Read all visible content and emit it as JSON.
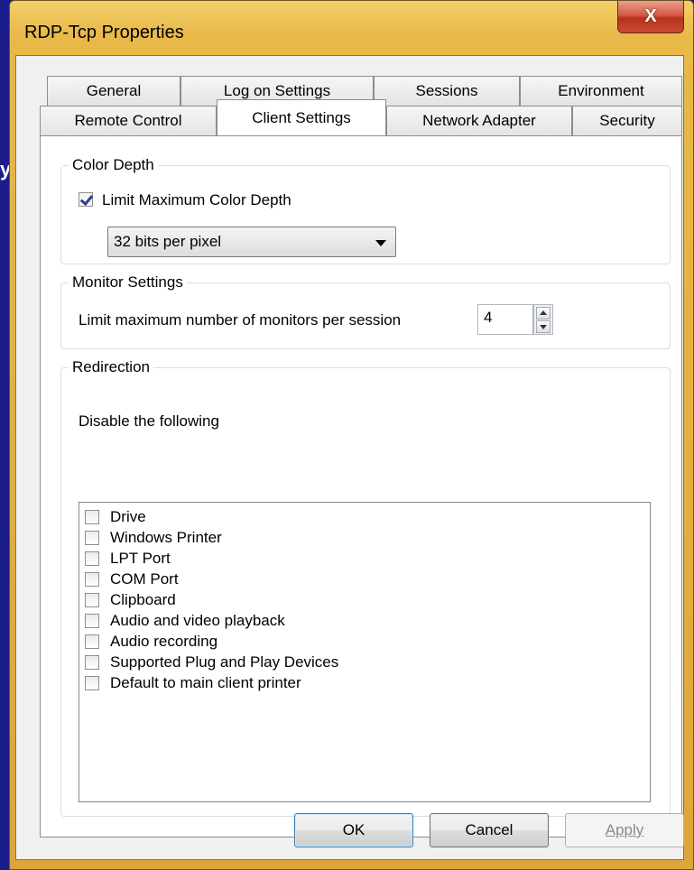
{
  "window": {
    "title": "RDP-Tcp Properties",
    "close_glyph": "X"
  },
  "tabs": {
    "row1": [
      "General",
      "Log on Settings",
      "Sessions",
      "Environment"
    ],
    "row2": [
      "Remote Control",
      "Client Settings",
      "Network Adapter",
      "Security"
    ],
    "active": "Client Settings"
  },
  "color_depth": {
    "legend": "Color Depth",
    "limit_label": "Limit Maximum Color Depth",
    "limit_checked": true,
    "selected_option": "32 bits per pixel"
  },
  "monitor": {
    "legend": "Monitor Settings",
    "label": "Limit maximum number of monitors per session",
    "value": "4"
  },
  "redirection": {
    "legend": "Redirection",
    "instruction": "Disable the following",
    "items": [
      {
        "label": "Drive",
        "checked": false
      },
      {
        "label": "Windows Printer",
        "checked": false
      },
      {
        "label": "LPT Port",
        "checked": false
      },
      {
        "label": "COM Port",
        "checked": false
      },
      {
        "label": "Clipboard",
        "checked": false
      },
      {
        "label": "Audio and video playback",
        "checked": false
      },
      {
        "label": "Audio recording",
        "checked": false
      },
      {
        "label": "Supported Plug and Play Devices",
        "checked": false
      },
      {
        "label": "Default to main client printer",
        "checked": false
      }
    ]
  },
  "buttons": {
    "ok": "OK",
    "cancel": "Cancel",
    "apply": "Apply"
  },
  "background_glyph": "y",
  "colors": {
    "frame": "#e8b848",
    "close": "#c84a32",
    "desktop": "#1c1c8a"
  }
}
